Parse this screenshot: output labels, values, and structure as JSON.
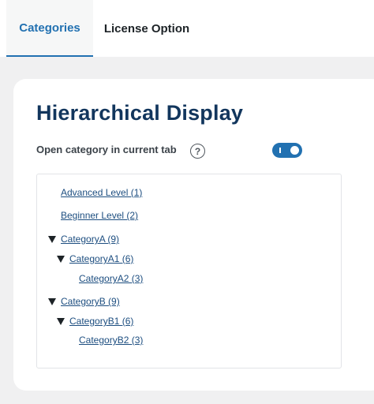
{
  "tabs": [
    {
      "label": "Categories",
      "active": true
    },
    {
      "label": "License Option",
      "active": false
    }
  ],
  "section": {
    "title": "Hierarchical Display",
    "option_label": "Open category in current tab",
    "help_glyph": "?",
    "toggle_on": true
  },
  "tree": {
    "advanced": "Advanced Level (1)",
    "beginner": "Beginner Level (2)",
    "catA": "CategoryA (9)",
    "catA1": "CategoryA1 (6)",
    "catA2": "CategoryA2 (3)",
    "catB": "CategoryB (9)",
    "catB1": "CategoryB1 (6)",
    "catB2": "CategoryB2 (3)"
  },
  "colors": {
    "accent": "#2271b1",
    "title": "#12365d",
    "link": "#1d4e80"
  }
}
